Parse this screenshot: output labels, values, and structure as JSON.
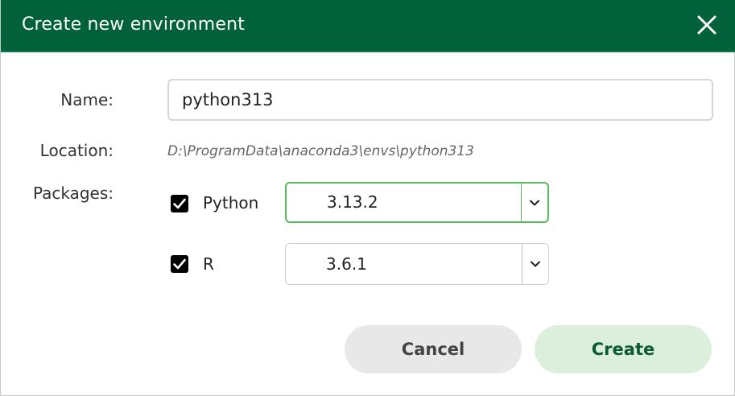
{
  "dialog": {
    "title": "Create new environment",
    "close_icon": "close-icon"
  },
  "form": {
    "name_label": "Name:",
    "name_value": "python313",
    "location_label": "Location:",
    "location_value": "D:\\ProgramData\\anaconda3\\envs\\python313",
    "packages_label": "Packages:"
  },
  "packages": [
    {
      "label": "Python",
      "checked": true,
      "version": "3.13.2",
      "focused": true
    },
    {
      "label": "R",
      "checked": true,
      "version": "3.6.1",
      "focused": false
    }
  ],
  "buttons": {
    "cancel": "Cancel",
    "create": "Create"
  },
  "colors": {
    "titlebar": "#00613a",
    "focus_border": "#5cb85c",
    "create_bg": "#dcefdc",
    "cancel_bg": "#e8e8e8"
  }
}
